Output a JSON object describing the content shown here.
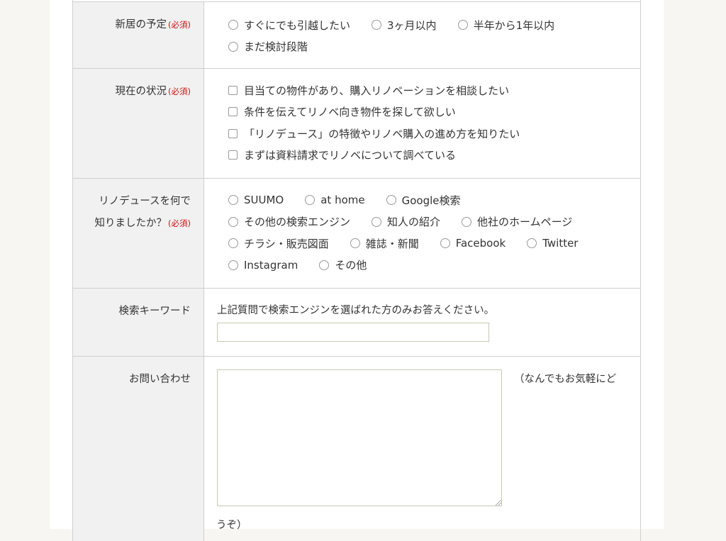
{
  "form": {
    "move_plan": {
      "label": "新居の予定",
      "required": "(必須)",
      "options": [
        "すぐにでも引越したい",
        "3ヶ月以内",
        "半年から1年以内",
        "まだ検討段階"
      ]
    },
    "current_status": {
      "label": "現在の状況",
      "required": "(必須)",
      "options": [
        "目当ての物件があり、購入リノベーションを相談したい",
        "条件を伝えてリノベ向き物件を探して欲しい",
        "「リノデュース」の特徴やリノベ購入の進め方を知りたい",
        "まずは資料請求でリノベについて調べている"
      ]
    },
    "referral": {
      "label_line1": "リノデュースを何で",
      "label_line2": "知りましたか？",
      "required": "(必須)",
      "options": [
        "SUUMO",
        "at home",
        "Google検索",
        "その他の検索エンジン",
        "知人の紹介",
        "他社のホームページ",
        "チラシ・販売図面",
        "雑誌・新聞",
        "Facebook",
        "Twitter",
        "Instagram",
        "その他"
      ]
    },
    "keyword": {
      "label": "検索キーワード",
      "note": "上記質問で検索エンジンを選ばれた方のみお答えください。",
      "value": ""
    },
    "inquiry": {
      "label": "お問い合わせ",
      "value": "",
      "aside": "（なんでもお気軽にど",
      "aside_tail": "うぞ）"
    }
  }
}
